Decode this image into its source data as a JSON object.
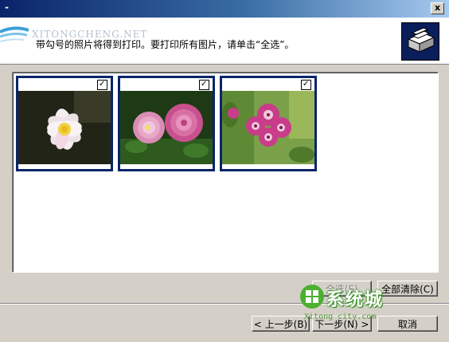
{
  "titlebar": {
    "mark": "-",
    "close_label": "x"
  },
  "header": {
    "brand_text": "XITONGCHENG.NET",
    "instruction": "带勾号的照片将得到打印。要打印所有图片，请单击“全选”。"
  },
  "photos": [
    {
      "name": "lotus",
      "checked": true,
      "check_mark": "✓"
    },
    {
      "name": "pink-peonies",
      "checked": true,
      "check_mark": "✓"
    },
    {
      "name": "geranium",
      "checked": true,
      "check_mark": "✓"
    }
  ],
  "buttons": {
    "select_all": "全选(S)",
    "clear_all": "全部清除(C)",
    "back": "< 上一步(B)",
    "next": "下一步(N) >",
    "cancel": "取消"
  },
  "watermark": {
    "main": "系统城",
    "sub": "Xitong city.com"
  }
}
